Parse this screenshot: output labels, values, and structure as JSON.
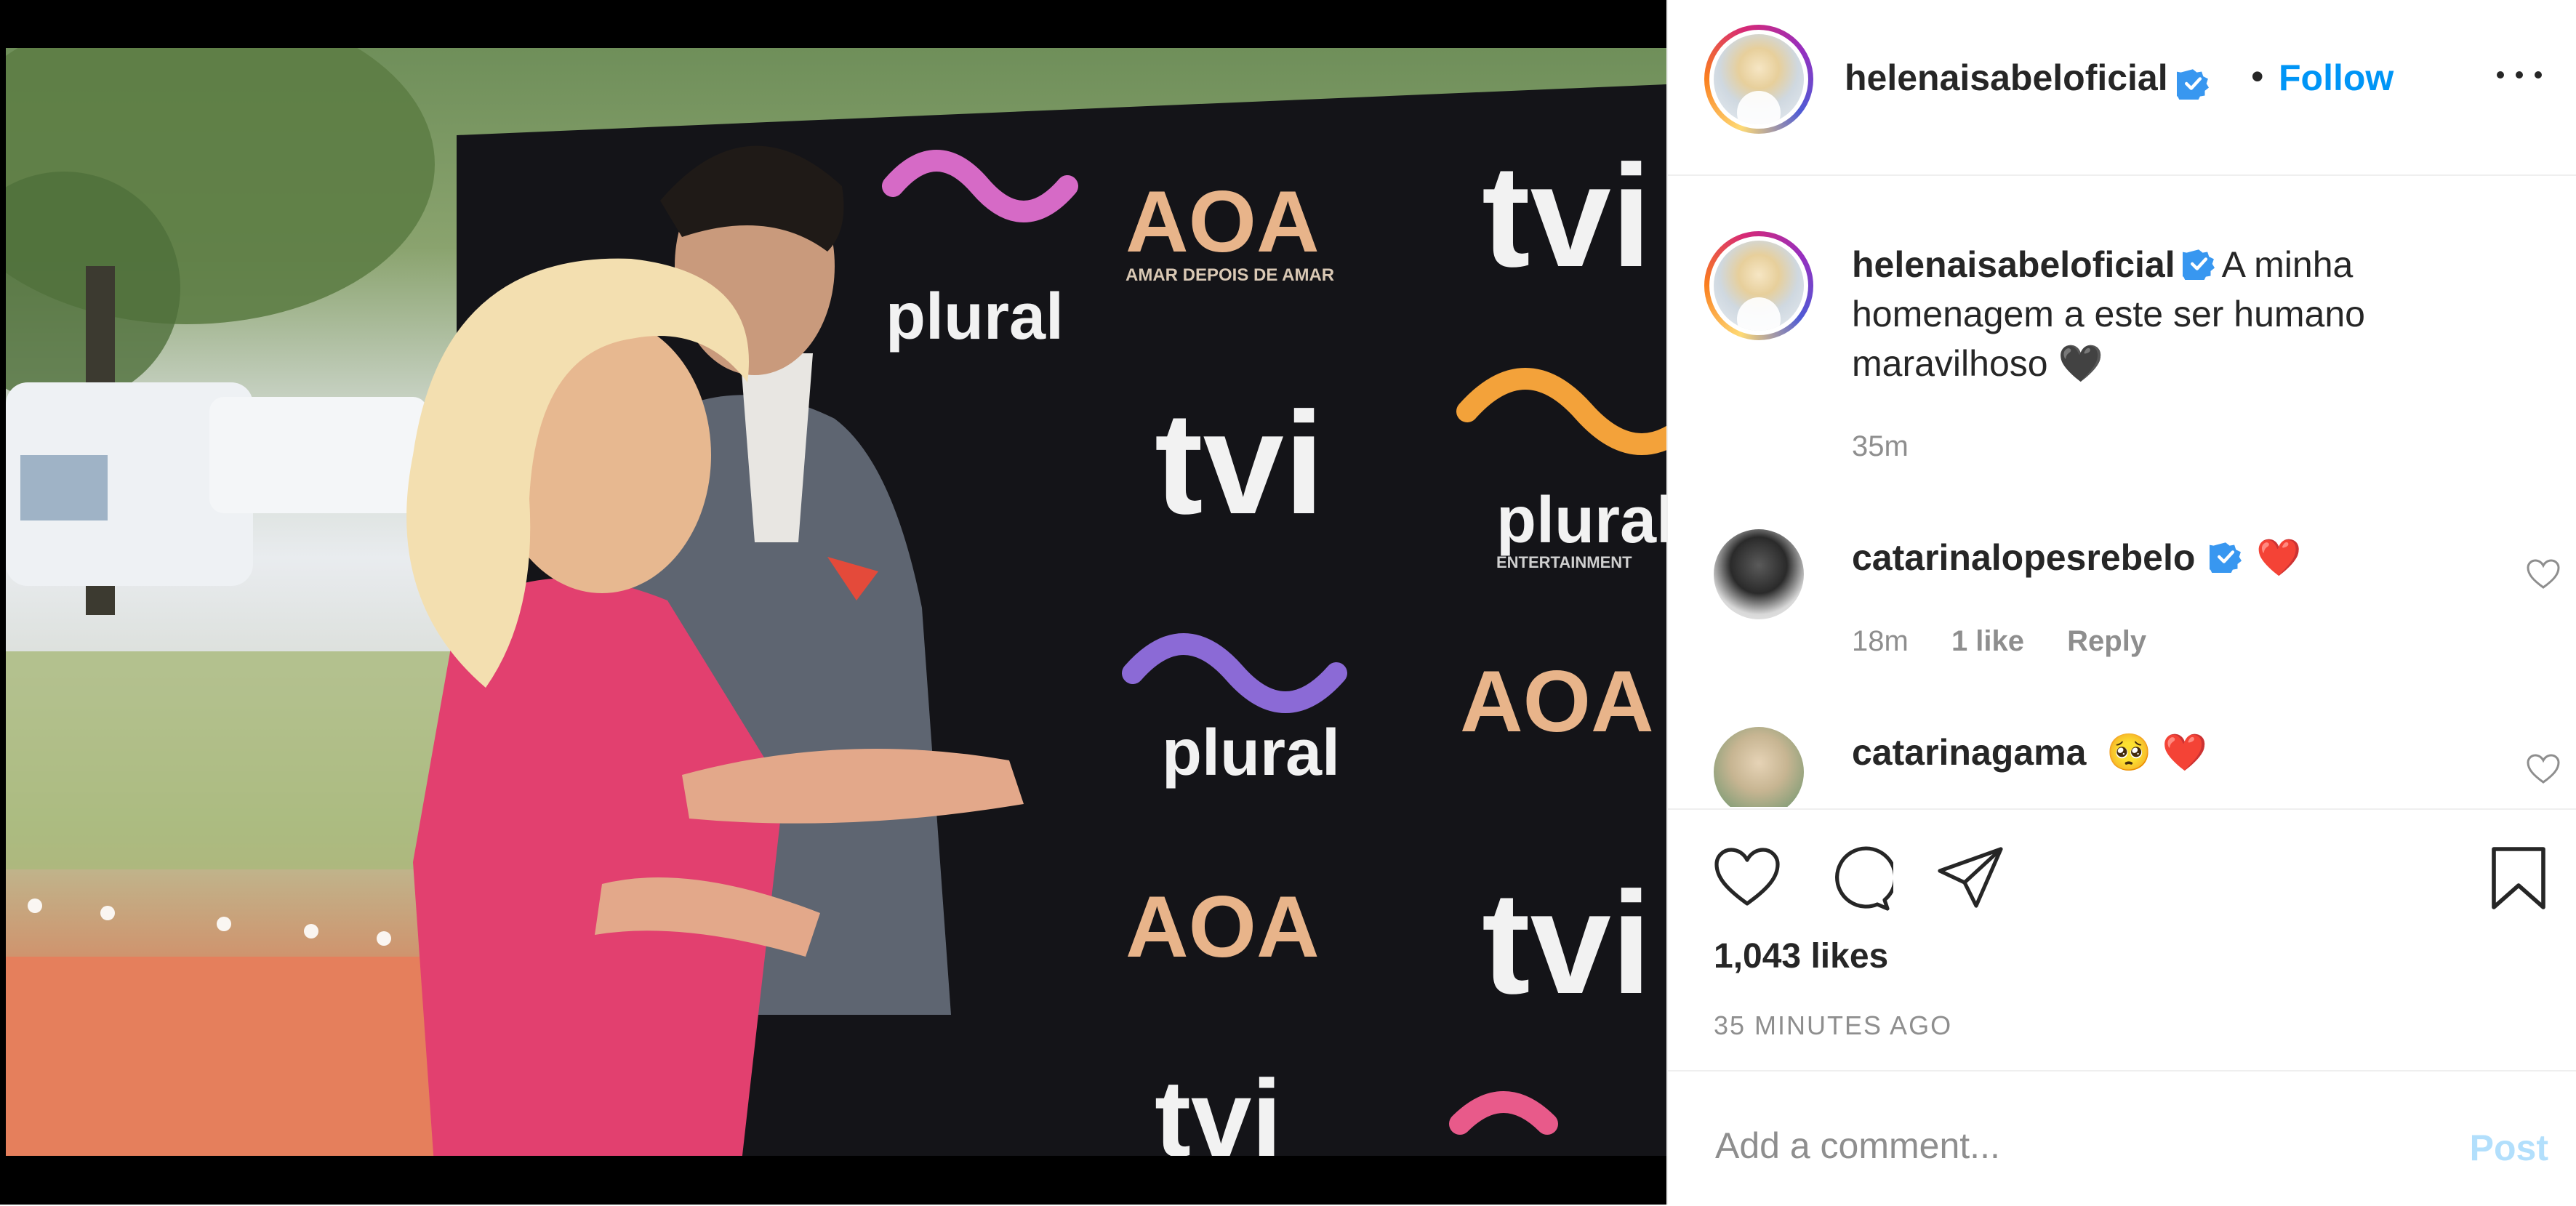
{
  "post": {
    "username": "helenaisabeloficial",
    "follow_label": "Follow",
    "separator": "•",
    "caption": "A minha homenagem a este ser humano maravilhoso 🖤",
    "caption_time": "35m",
    "likes": "1,043 likes",
    "posted_ago": "35 MINUTES AGO"
  },
  "photo": {
    "backdrop_logos": [
      "AOA",
      "AMAR DEPOIS DE AMAR",
      "tvi",
      "plural",
      "ENTERTAINMENT"
    ]
  },
  "comments": [
    {
      "username": "catarinalopesrebelo",
      "verified": true,
      "text": "❤️",
      "time": "18m",
      "likes": "1 like",
      "reply": "Reply"
    },
    {
      "username": "catarinagama",
      "verified": false,
      "text": "🥺 ❤️"
    }
  ],
  "composer": {
    "placeholder": "Add a comment...",
    "post_label": "Post"
  },
  "colors": {
    "accent": "#0095f6",
    "post_disabled": "#b2dffc",
    "secondary_text": "#8e8e8e",
    "divider": "#efefef"
  },
  "icons": [
    "verified-badge-icon",
    "more-options-icon",
    "heart-icon",
    "comment-icon",
    "share-icon",
    "bookmark-icon"
  ]
}
